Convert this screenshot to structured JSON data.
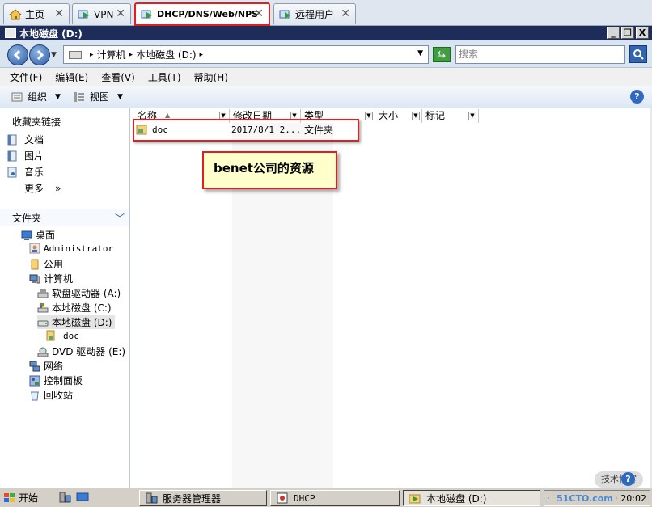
{
  "tabs": [
    {
      "label": "主页",
      "icon": "home-icon"
    },
    {
      "label": "VPN",
      "icon": "vm-icon"
    },
    {
      "label": "DHCP/DNS/Web/NPS",
      "icon": "vm-icon",
      "active": true
    },
    {
      "label": "远程用户",
      "icon": "vm-icon"
    }
  ],
  "tab_close": "✕",
  "window": {
    "title": "本地磁盘  (D:)",
    "min": "_",
    "restore": "❐",
    "close": "X"
  },
  "address": {
    "parts": [
      "计算机",
      "本地磁盘  (D:)"
    ],
    "search_placeholder": "搜索"
  },
  "menu": [
    "文件(F)",
    "编辑(E)",
    "查看(V)",
    "工具(T)",
    "帮助(H)"
  ],
  "toolbar": {
    "organize": "组织",
    "views": "视图",
    "help": "?"
  },
  "favorites": {
    "header": "收藏夹链接",
    "items": [
      "文档",
      "图片",
      "音乐"
    ],
    "more": "更多",
    "more_arrow": "»"
  },
  "folders": {
    "header": "文件夹",
    "tree": [
      {
        "label": "桌面",
        "icon": "desktop-icon",
        "level": 0
      },
      {
        "label": "Administrator",
        "icon": "user-folder-icon",
        "level": 1,
        "mono": true
      },
      {
        "label": "公用",
        "icon": "folder-icon",
        "level": 1
      },
      {
        "label": "计算机",
        "icon": "computer-icon",
        "level": 1
      },
      {
        "label": "软盘驱动器  (A:)",
        "icon": "floppy-icon",
        "level": 2
      },
      {
        "label": "本地磁盘  (C:)",
        "icon": "drive-c-icon",
        "level": 2
      },
      {
        "label": "本地磁盘  (D:)",
        "icon": "drive-icon",
        "level": 2,
        "selected": true
      },
      {
        "label": "doc",
        "icon": "shared-folder-icon",
        "level": 3,
        "mono": true
      },
      {
        "label": "DVD 驱动器  (E:)",
        "icon": "dvd-icon",
        "level": 2
      },
      {
        "label": "网络",
        "icon": "network-icon",
        "level": 1
      },
      {
        "label": "控制面板",
        "icon": "control-panel-icon",
        "level": 1
      },
      {
        "label": "回收站",
        "icon": "recycle-bin-icon",
        "level": 1
      }
    ]
  },
  "columns": [
    "名称",
    "修改日期",
    "类型",
    "大小",
    "标记"
  ],
  "files": [
    {
      "name": "doc",
      "modified": "2017/8/1 2...",
      "type": "文件夹"
    }
  ],
  "callout": "benet公司的资源",
  "taskbar": {
    "start": "开始",
    "buttons": [
      "服务器管理器",
      "DHCP",
      "本地磁盘  (D:)"
    ],
    "clock": "20:02"
  },
  "watermark": "51CTO.com",
  "watermark_badge": "技术博客"
}
